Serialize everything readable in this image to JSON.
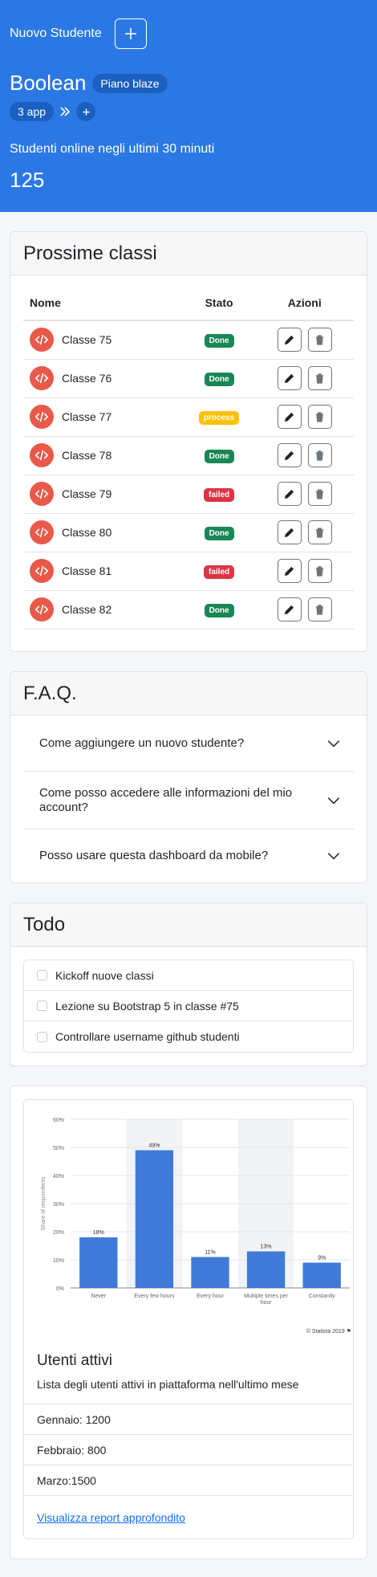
{
  "header": {
    "new_student_label": "Nuovo Studente",
    "brand": "Boolean",
    "plan": "Piano blaze",
    "apps": "3 app",
    "online_label": "Studenti online negli ultimi 30 minuti",
    "online_count": "125",
    "accent": "#2b78e4"
  },
  "classes": {
    "title": "Prossime classi",
    "columns": [
      "Nome",
      "Stato",
      "Azioni"
    ],
    "rows": [
      {
        "name": "Classe 75",
        "status": "Done",
        "color": "#198754"
      },
      {
        "name": "Classe 76",
        "status": "Done",
        "color": "#198754"
      },
      {
        "name": "Classe 77",
        "status": "process",
        "color": "#ffc107"
      },
      {
        "name": "Classe 78",
        "status": "Done",
        "color": "#198754"
      },
      {
        "name": "Classe 79",
        "status": "failed",
        "color": "#dc3545"
      },
      {
        "name": "Classe 80",
        "status": "Done",
        "color": "#198754"
      },
      {
        "name": "Classe 81",
        "status": "failed",
        "color": "#dc3545"
      },
      {
        "name": "Classe 82",
        "status": "Done",
        "color": "#198754"
      }
    ]
  },
  "faq": {
    "title": "F.A.Q.",
    "items": [
      "Come aggiungere un nuovo studente?",
      "Come posso accedere alle informazioni del mio account?",
      "Posso usare questa dashboard da mobile?"
    ]
  },
  "todo": {
    "title": "Todo",
    "items": [
      "Kickoff nuove classi",
      "Lezione su Bootstrap 5 in classe #75",
      "Controllare username github studenti"
    ]
  },
  "stats": {
    "title": "Utenti attivi",
    "subtitle": "Lista degli utenti attivi in piattaforma nell'ultimo mese",
    "months": [
      "Gennaio: 1200",
      "Febbraio: 800",
      "Marzo:1500"
    ],
    "report_link": "Visualizza report approfondito"
  },
  "chart_data": {
    "type": "bar",
    "categories": [
      "Never",
      "Every few hours",
      "Every hour",
      "Multiple times per hour",
      "Constantly"
    ],
    "values": [
      18,
      49,
      11,
      13,
      9
    ],
    "value_labels": [
      "18%",
      "49%",
      "11%",
      "13%",
      "9%"
    ],
    "ylabel": "Share of respondents",
    "yticks": [
      "0%",
      "10%",
      "20%",
      "30%",
      "40%",
      "50%",
      "60%"
    ],
    "ylim": [
      0,
      60
    ],
    "credit": "© Statista 2019",
    "bar_color": "#3f7ad8",
    "grid": true
  }
}
